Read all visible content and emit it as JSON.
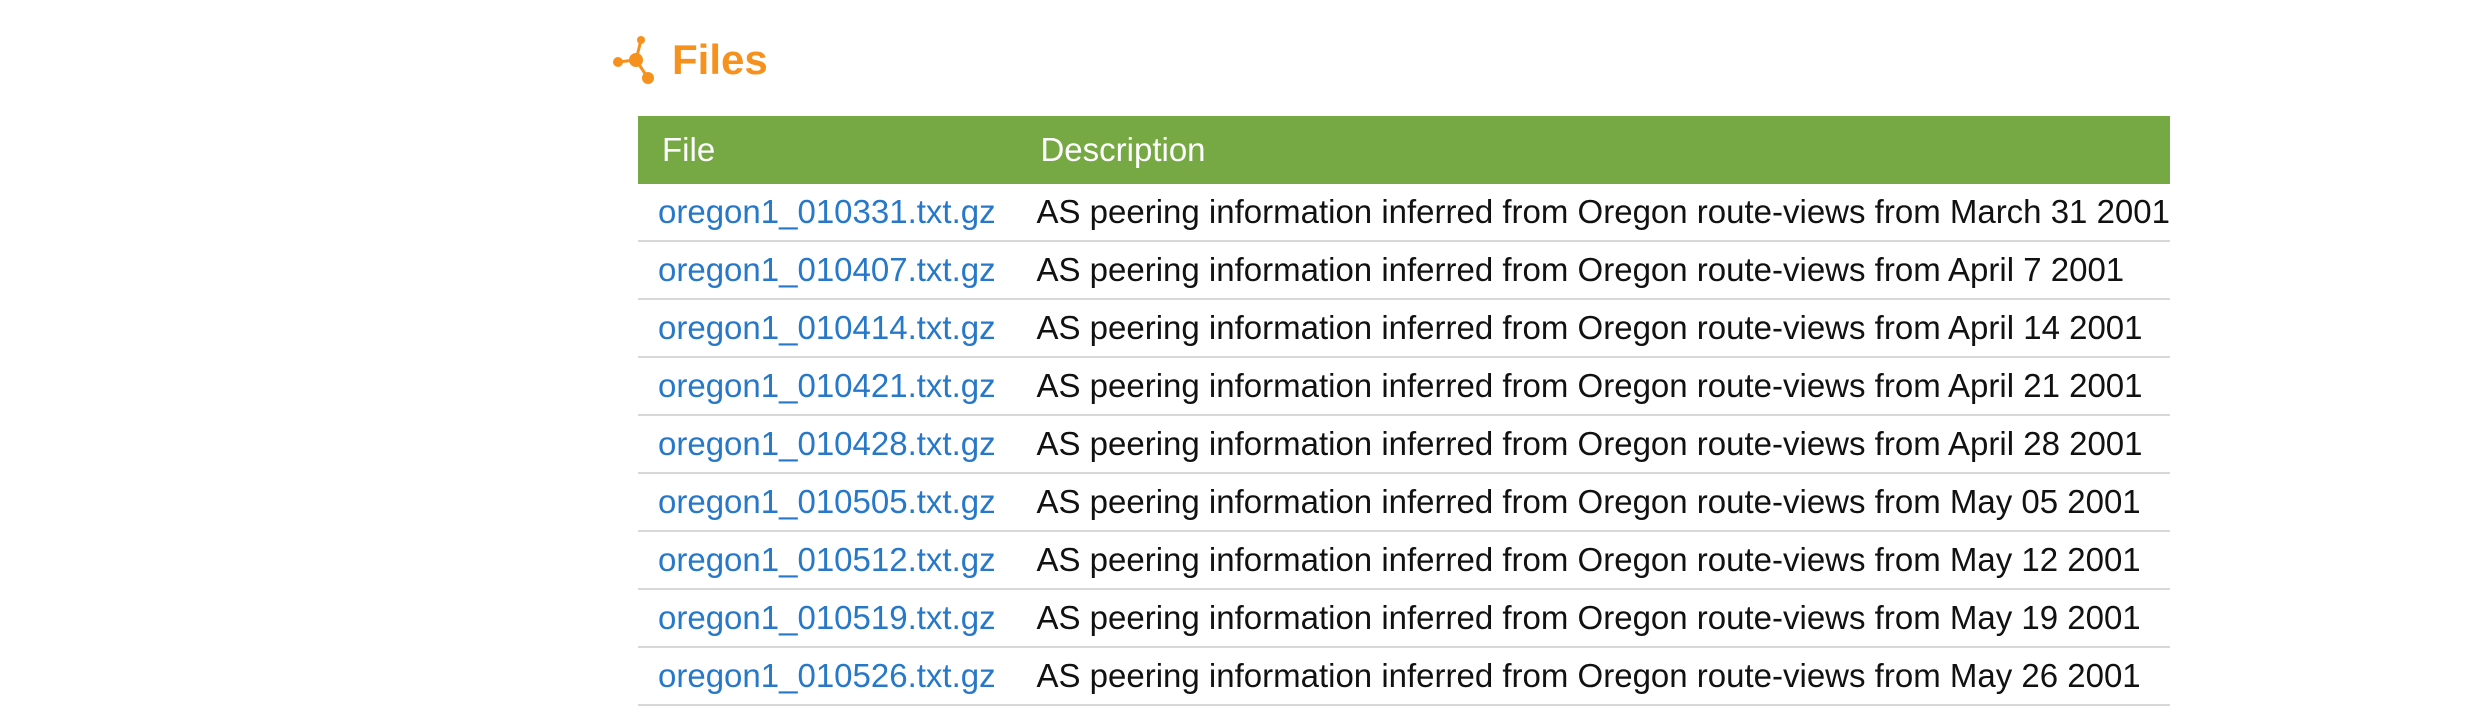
{
  "section": {
    "title": "Files",
    "icon": "network-nodes-icon",
    "accent_color": "#f7911d"
  },
  "table": {
    "header_color": "#76a844",
    "link_color": "#2778c8",
    "columns": [
      "File",
      "Description"
    ],
    "rows": [
      {
        "file": "oregon1_010331.txt.gz",
        "description": "AS peering information inferred from Oregon route-views from March 31 2001"
      },
      {
        "file": "oregon1_010407.txt.gz",
        "description": "AS peering information inferred from Oregon route-views from April 7 2001"
      },
      {
        "file": "oregon1_010414.txt.gz",
        "description": "AS peering information inferred from Oregon route-views from April 14 2001"
      },
      {
        "file": "oregon1_010421.txt.gz",
        "description": "AS peering information inferred from Oregon route-views from April 21 2001"
      },
      {
        "file": "oregon1_010428.txt.gz",
        "description": "AS peering information inferred from Oregon route-views from April 28 2001"
      },
      {
        "file": "oregon1_010505.txt.gz",
        "description": "AS peering information inferred from Oregon route-views from May 05 2001"
      },
      {
        "file": "oregon1_010512.txt.gz",
        "description": "AS peering information inferred from Oregon route-views from May 12 2001"
      },
      {
        "file": "oregon1_010519.txt.gz",
        "description": "AS peering information inferred from Oregon route-views from May 19 2001"
      },
      {
        "file": "oregon1_010526.txt.gz",
        "description": "AS peering information inferred from Oregon route-views from May 26 2001"
      }
    ]
  }
}
